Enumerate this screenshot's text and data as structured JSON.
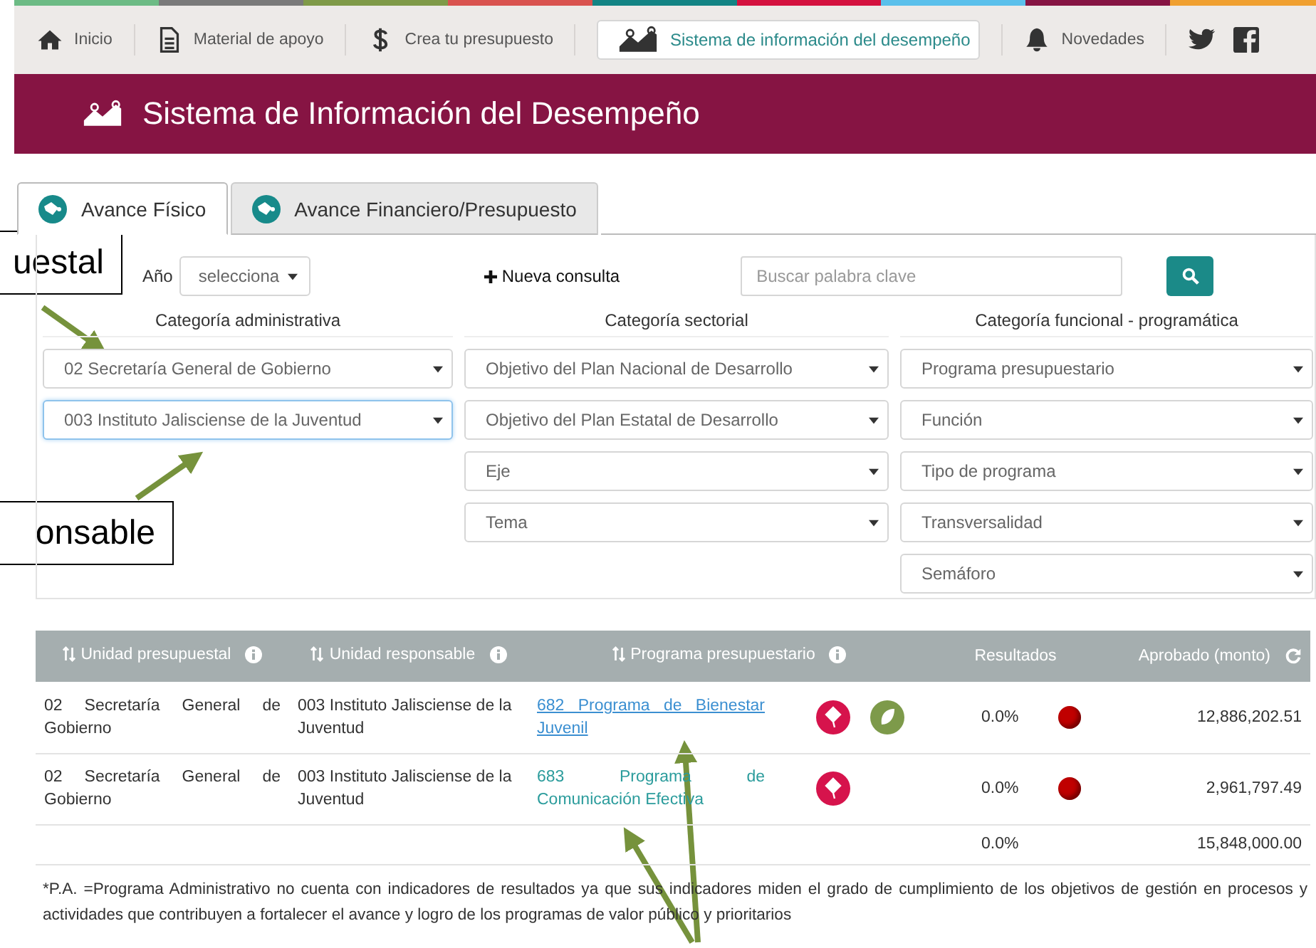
{
  "nav": {
    "items": [
      {
        "label": "Inicio",
        "selected": false
      },
      {
        "label": "Material de apoyo",
        "selected": false
      },
      {
        "label": "Crea tu presupuesto",
        "selected": false
      },
      {
        "label": "Sistema de información del desempeño",
        "selected": true
      },
      {
        "label": "Novedades",
        "selected": false
      }
    ]
  },
  "header": {
    "title": "Sistema de Información del Desempeño"
  },
  "tabs": [
    {
      "label": "Avance Físico",
      "selected": true
    },
    {
      "label": "Avance Financiero/Presupuesto",
      "selected": false
    }
  ],
  "filters": {
    "year_label": "Año",
    "year_value": "selecciona",
    "new_query": "Nueva consulta",
    "search": {
      "placeholder": "Buscar palabra clave"
    },
    "columns": [
      {
        "title": "Categoría administrativa",
        "selects": [
          {
            "value": "02 Secretaría General de Gobierno",
            "focused": false
          },
          {
            "value": "003 Instituto Jalisciense de la Juventud",
            "focused": true
          }
        ]
      },
      {
        "title": "Categoría sectorial",
        "selects": [
          {
            "value": "Objetivo del Plan Nacional de Desarrollo",
            "focused": false
          },
          {
            "value": "Objetivo del Plan Estatal de Desarrollo",
            "focused": false
          },
          {
            "value": "Eje",
            "focused": false
          },
          {
            "value": "Tema",
            "focused": false
          }
        ]
      },
      {
        "title": "Categoría funcional - programática",
        "selects": [
          {
            "value": "Programa presupuestario",
            "focused": false
          },
          {
            "value": "Función",
            "focused": false
          },
          {
            "value": "Tipo de programa",
            "focused": false
          },
          {
            "value": "Transversalidad",
            "focused": false
          },
          {
            "value": "Semáforo",
            "focused": false
          }
        ]
      }
    ]
  },
  "table": {
    "columns": [
      {
        "label": "Unidad presupuestal",
        "kind": "sortable"
      },
      {
        "label": "Unidad responsable",
        "kind": "sortable"
      },
      {
        "label": "Programa presupuestario",
        "kind": "sortable"
      },
      {
        "label": "Resultados",
        "kind": "plain"
      },
      {
        "label": "Aprobado (monto)",
        "kind": "refresh"
      }
    ],
    "rows": [
      {
        "unidad_presupuestal": "02 Secretaría General de Gobierno",
        "unidad_responsable": "003 Instituto Jalisciense de la Juventud",
        "programa": "682 Programa de Bienestar Juvenil",
        "underlined": true,
        "badges": [
          {
            "kind": "kite"
          },
          {
            "kind": "leaf"
          }
        ],
        "resultado": "0.0%",
        "aprobado": "12,886,202.51"
      },
      {
        "unidad_presupuestal": "02 Secretaría General de Gobierno",
        "unidad_responsable": "003 Instituto Jalisciense de la Juventud",
        "programa": "683 Programa de Comunicación Efectiva",
        "underlined": false,
        "badges": [
          {
            "kind": "kite"
          }
        ],
        "resultado": "0.0%",
        "aprobado": "2,961,797.49"
      }
    ],
    "total": {
      "resultado": "0.0%",
      "aprobado": "15,848,000.00"
    }
  },
  "footnote": "*P.A. =Programa Administrativo no cuenta con indicadores de resultados ya que sus indicadores miden el grado de cumplimiento de los objetivos de gestión en procesos y actividades que contribuyen a fortalecer el avance y logro de los programas de valor público y prioritarios",
  "callouts": [
    "uestal",
    "onsable"
  ]
}
